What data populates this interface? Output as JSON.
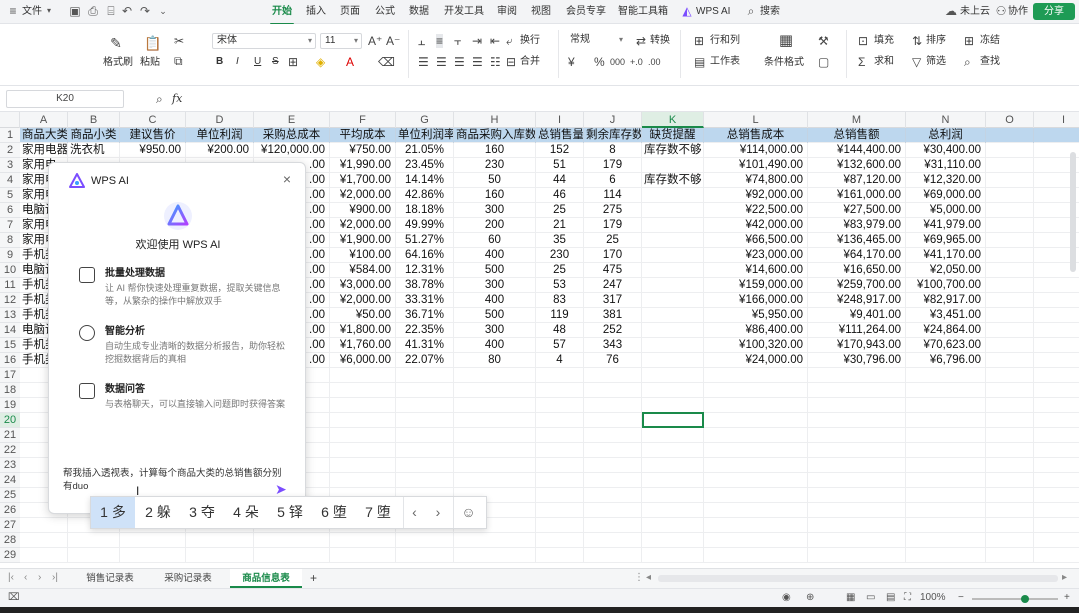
{
  "menubar": {
    "file": "文件",
    "tabs": [
      "开始",
      "插入",
      "页面",
      "公式",
      "数据",
      "开发工具",
      "审阅",
      "视图",
      "会员专享",
      "智能工具箱",
      "WPS AI"
    ],
    "active_tab": "开始",
    "search": "搜索",
    "cloud": "未上云",
    "collab": "协作",
    "share": "分享"
  },
  "ribbon": {
    "format_painter": "格式刷",
    "paste": "粘贴",
    "font_name": "宋体",
    "font_size": "11",
    "bold": "B",
    "italic": "I",
    "underline": "U",
    "strike": "S",
    "wrap": "换行",
    "merge": "合并",
    "number_format": "常规",
    "convert": "转换",
    "row_col": "行和列",
    "worksheet": "工作表",
    "cond_format": "条件格式",
    "fill": "填充",
    "sort": "排序",
    "freeze": "冻结",
    "sum": "求和",
    "filter": "筛选",
    "find": "查找"
  },
  "formula_bar": {
    "name_box": "K20",
    "fx": "fx"
  },
  "grid": {
    "columns": [
      "A",
      "B",
      "C",
      "D",
      "E",
      "F",
      "G",
      "H",
      "I",
      "J",
      "K",
      "L",
      "M",
      "N",
      "O",
      "I"
    ],
    "selected_column": "K",
    "selected_row": "20",
    "header": [
      "商品大类",
      "商品小类",
      "建议售价",
      "单位利润",
      "采购总成本",
      "平均成本",
      "单位利润率",
      "商品采购入库数",
      "总销售量",
      "剩余库存数",
      "缺货提醒",
      "总销售成本",
      "总销售额",
      "总利润"
    ],
    "rows": [
      [
        "家用电器",
        "洗衣机",
        "¥950.00",
        "¥200.00",
        "¥120,000.00",
        "¥750.00",
        "21.05%",
        "160",
        "152",
        "8",
        "库存数不够",
        "¥114,000.00",
        "¥144,400.00",
        "¥30,400.00"
      ],
      [
        "家用电",
        "",
        "",
        "",
        ".00",
        "¥1,990.00",
        "23.45%",
        "230",
        "51",
        "179",
        "",
        "¥101,490.00",
        "¥132,600.00",
        "¥31,110.00"
      ],
      [
        "家用电",
        "",
        "",
        "",
        ".00",
        "¥1,700.00",
        "14.14%",
        "50",
        "44",
        "6",
        "库存数不够",
        "¥74,800.00",
        "¥87,120.00",
        "¥12,320.00"
      ],
      [
        "家用电",
        "",
        "",
        "",
        ".00",
        "¥2,000.00",
        "42.86%",
        "160",
        "46",
        "114",
        "",
        "¥92,000.00",
        "¥161,000.00",
        "¥69,000.00"
      ],
      [
        "电脑设",
        "",
        "",
        "",
        ".00",
        "¥900.00",
        "18.18%",
        "300",
        "25",
        "275",
        "",
        "¥22,500.00",
        "¥27,500.00",
        "¥5,000.00"
      ],
      [
        "家用电",
        "",
        "",
        "",
        ".00",
        "¥2,000.00",
        "49.99%",
        "200",
        "21",
        "179",
        "",
        "¥42,000.00",
        "¥83,979.00",
        "¥41,979.00"
      ],
      [
        "家用电",
        "",
        "",
        "",
        ".00",
        "¥1,900.00",
        "51.27%",
        "60",
        "35",
        "25",
        "",
        "¥66,500.00",
        "¥136,465.00",
        "¥69,965.00"
      ],
      [
        "手机类",
        "",
        "",
        "",
        ".00",
        "¥100.00",
        "64.16%",
        "400",
        "230",
        "170",
        "",
        "¥23,000.00",
        "¥64,170.00",
        "¥41,170.00"
      ],
      [
        "电脑设",
        "",
        "",
        "",
        ".00",
        "¥584.00",
        "12.31%",
        "500",
        "25",
        "475",
        "",
        "¥14,600.00",
        "¥16,650.00",
        "¥2,050.00"
      ],
      [
        "手机类",
        "",
        "",
        "",
        ".00",
        "¥3,000.00",
        "38.78%",
        "300",
        "53",
        "247",
        "",
        "¥159,000.00",
        "¥259,700.00",
        "¥100,700.00"
      ],
      [
        "手机类",
        "",
        "",
        "",
        ".00",
        "¥2,000.00",
        "33.31%",
        "400",
        "83",
        "317",
        "",
        "¥166,000.00",
        "¥248,917.00",
        "¥82,917.00"
      ],
      [
        "手机类",
        "",
        "",
        "",
        ".00",
        "¥50.00",
        "36.71%",
        "500",
        "119",
        "381",
        "",
        "¥5,950.00",
        "¥9,401.00",
        "¥3,451.00"
      ],
      [
        "电脑设",
        "",
        "",
        "",
        ".00",
        "¥1,800.00",
        "22.35%",
        "300",
        "48",
        "252",
        "",
        "¥86,400.00",
        "¥111,264.00",
        "¥24,864.00"
      ],
      [
        "手机类",
        "",
        "",
        "",
        ".00",
        "¥1,760.00",
        "41.31%",
        "400",
        "57",
        "343",
        "",
        "¥100,320.00",
        "¥170,943.00",
        "¥70,623.00"
      ],
      [
        "手机类",
        "",
        "",
        "",
        ".00",
        "¥6,000.00",
        "22.07%",
        "80",
        "4",
        "76",
        "",
        "¥24,000.00",
        "¥30,796.00",
        "¥6,796.00"
      ]
    ],
    "row_numbers": [
      "1",
      "2",
      "3",
      "4",
      "5",
      "6",
      "7",
      "8",
      "9",
      "10",
      "11",
      "12",
      "13",
      "14",
      "15",
      "16",
      "17",
      "18",
      "19",
      "20",
      "21",
      "22",
      "23",
      "24",
      "25",
      "26",
      "27",
      "28",
      "29"
    ]
  },
  "ai_panel": {
    "title": "WPS AI",
    "welcome": "欢迎使用 WPS AI",
    "features": [
      {
        "title": "批量处理数据",
        "desc": "让 AI 帮你快速处理重复数据，提取关键信息等，从繁杂的操作中解放双手"
      },
      {
        "title": "智能分析",
        "desc": "自动生成专业清晰的数据分析报告，助你轻松挖掘数据背后的真相"
      },
      {
        "title": "数据问答",
        "desc": "与表格聊天，可以直接输入问题即时获得答案"
      }
    ],
    "input_text": "帮我插入透视表，计算每个商品大类的总销售额分别有duo"
  },
  "ime": {
    "candidates": [
      "1 多",
      "2 躲",
      "3 夺",
      "4 朵",
      "5 铎",
      "6 堕",
      "7 堕"
    ],
    "selected": 0
  },
  "sheet_tabs": {
    "tabs": [
      "销售记录表",
      "采购记录表",
      "商品信息表"
    ],
    "active": "商品信息表",
    "add": "+"
  },
  "status": {
    "zoom": "100%"
  },
  "colors": {
    "accent": "#1a8a4a",
    "header_fill": "#bdd7ee",
    "ai_purple": "#7b4dff"
  }
}
